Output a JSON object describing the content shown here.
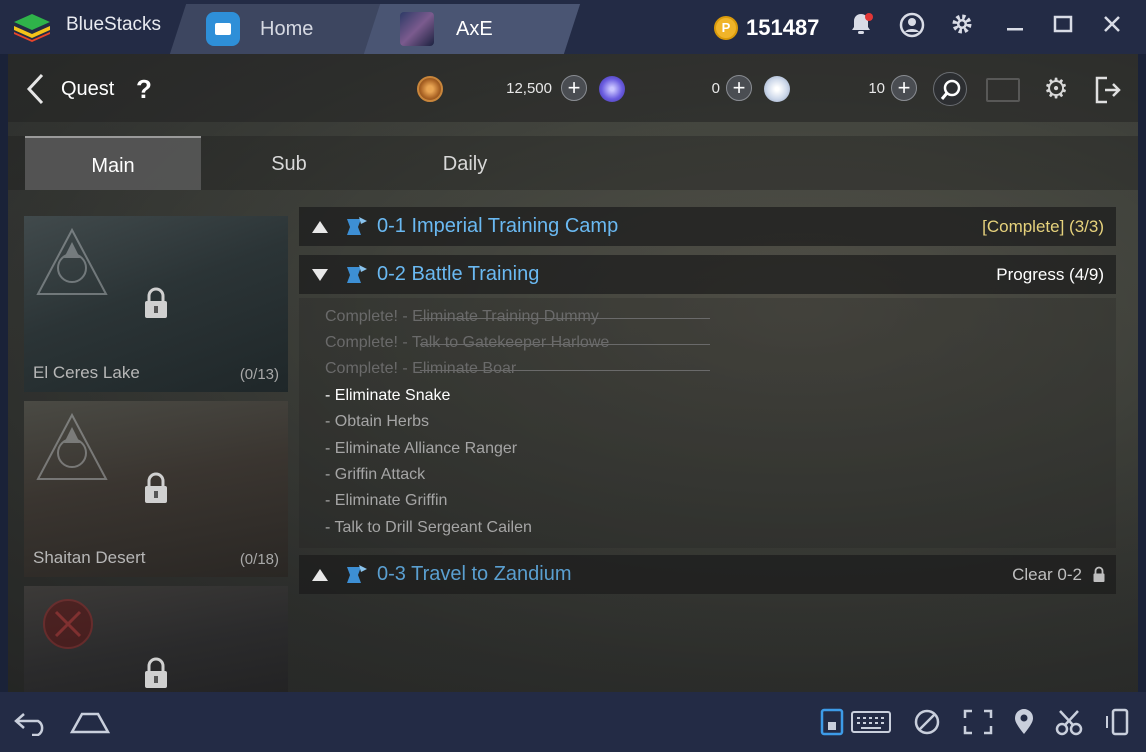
{
  "app": {
    "name": "BlueStacks"
  },
  "tabs": [
    {
      "label": "Home"
    },
    {
      "label": "AxE"
    }
  ],
  "coins": {
    "value": "151487"
  },
  "game": {
    "screen_title": "Quest",
    "help_symbol": "?",
    "currencies": [
      {
        "icon": "gold-coin-icon",
        "value": "12,500"
      },
      {
        "icon": "purple-gem-icon",
        "value": "0"
      },
      {
        "icon": "white-crystal-icon",
        "value": "10"
      }
    ],
    "quest_tabs": [
      {
        "label": "Main",
        "active": true
      },
      {
        "label": "Sub",
        "active": false
      },
      {
        "label": "Daily",
        "active": false
      }
    ],
    "regions": [
      {
        "name": "El Ceres Lake",
        "count": "(0/13)",
        "locked": true
      },
      {
        "name": "Shaitan Desert",
        "count": "(0/18)",
        "locked": true
      },
      {
        "name": "",
        "count": "",
        "locked": true
      }
    ],
    "quests": [
      {
        "title": "0-1 Imperial Training Camp",
        "status": "[Complete] (3/3)",
        "expanded": false
      },
      {
        "title": "0-2 Battle Training",
        "status": "Progress (4/9)",
        "expanded": true
      },
      {
        "title": "0-3 Travel to Zandium",
        "status": "Clear 0-2",
        "expanded": false
      }
    ],
    "objectives": [
      {
        "text": "Complete!  - Eliminate Training Dummy",
        "state": "done"
      },
      {
        "text": "Complete!  - Talk to Gatekeeper Harlowe",
        "state": "done"
      },
      {
        "text": "Complete!  - Eliminate Boar",
        "state": "done"
      },
      {
        "text": "- Eliminate Snake",
        "state": "current"
      },
      {
        "text": "- Obtain Herbs",
        "state": "pending"
      },
      {
        "text": "- Eliminate Alliance Ranger",
        "state": "pending"
      },
      {
        "text": "- Griffin Attack",
        "state": "pending"
      },
      {
        "text": "- Eliminate Griffin",
        "state": "pending"
      },
      {
        "text": "- Talk to Drill Sergeant Cailen",
        "state": "pending"
      }
    ]
  },
  "colors": {
    "quest_title": "#6ab9f2",
    "complete_status": "#e6d27c",
    "titlebar": "#232b45"
  }
}
